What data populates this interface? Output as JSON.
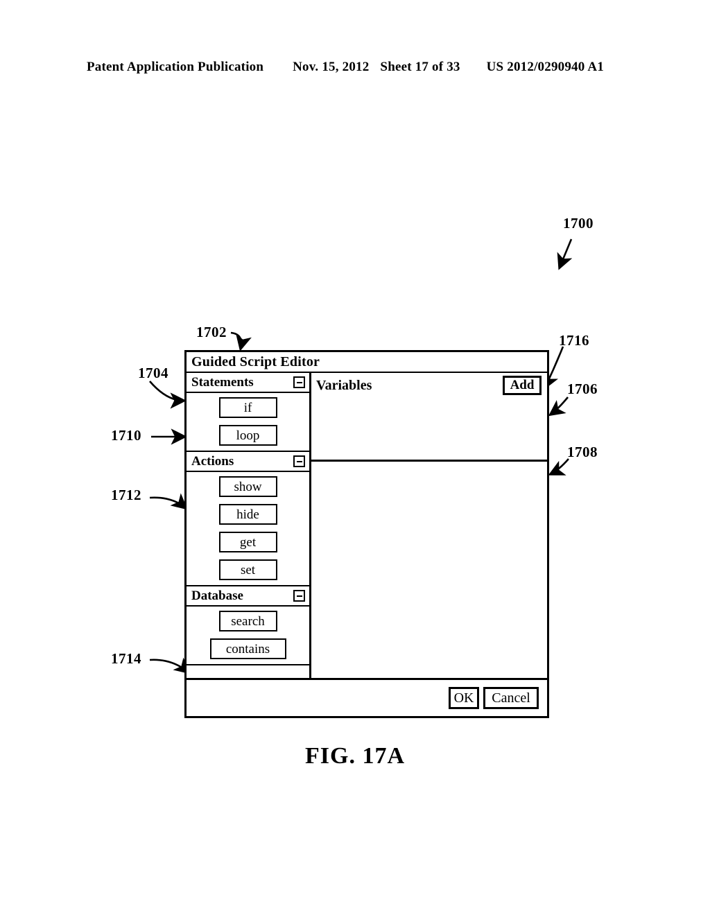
{
  "header": {
    "publication": "Patent Application Publication",
    "date": "Nov. 15, 2012",
    "sheet": "Sheet 17 of 33",
    "patent_number": "US 2012/0290940 A1"
  },
  "figure": {
    "caption": "FIG. 17A"
  },
  "reference_numerals": {
    "n1700": "1700",
    "n1702": "1702",
    "n1704": "1704",
    "n1706": "1706",
    "n1708": "1708",
    "n1710": "1710",
    "n1712": "1712",
    "n1714": "1714",
    "n1716": "1716"
  },
  "dialog": {
    "title": "Guided Script Editor",
    "palette": {
      "sections": [
        {
          "title": "Statements",
          "collapse_icon": "minus-box-icon",
          "items": [
            {
              "label": "if"
            },
            {
              "label": "loop"
            }
          ]
        },
        {
          "title": "Actions",
          "collapse_icon": "minus-box-icon",
          "items": [
            {
              "label": "show"
            },
            {
              "label": "hide"
            },
            {
              "label": "get"
            },
            {
              "label": "set"
            }
          ]
        },
        {
          "title": "Database",
          "collapse_icon": "minus-box-icon",
          "items": [
            {
              "label": "search"
            },
            {
              "label": "contains"
            }
          ]
        }
      ]
    },
    "variables": {
      "title": "Variables",
      "add_label": "Add",
      "top_pane_content": "",
      "bottom_pane_content": ""
    },
    "footer": {
      "ok_label": "OK",
      "cancel_label": "Cancel"
    }
  },
  "colors": {
    "ink": "#000000",
    "paper": "#ffffff"
  }
}
